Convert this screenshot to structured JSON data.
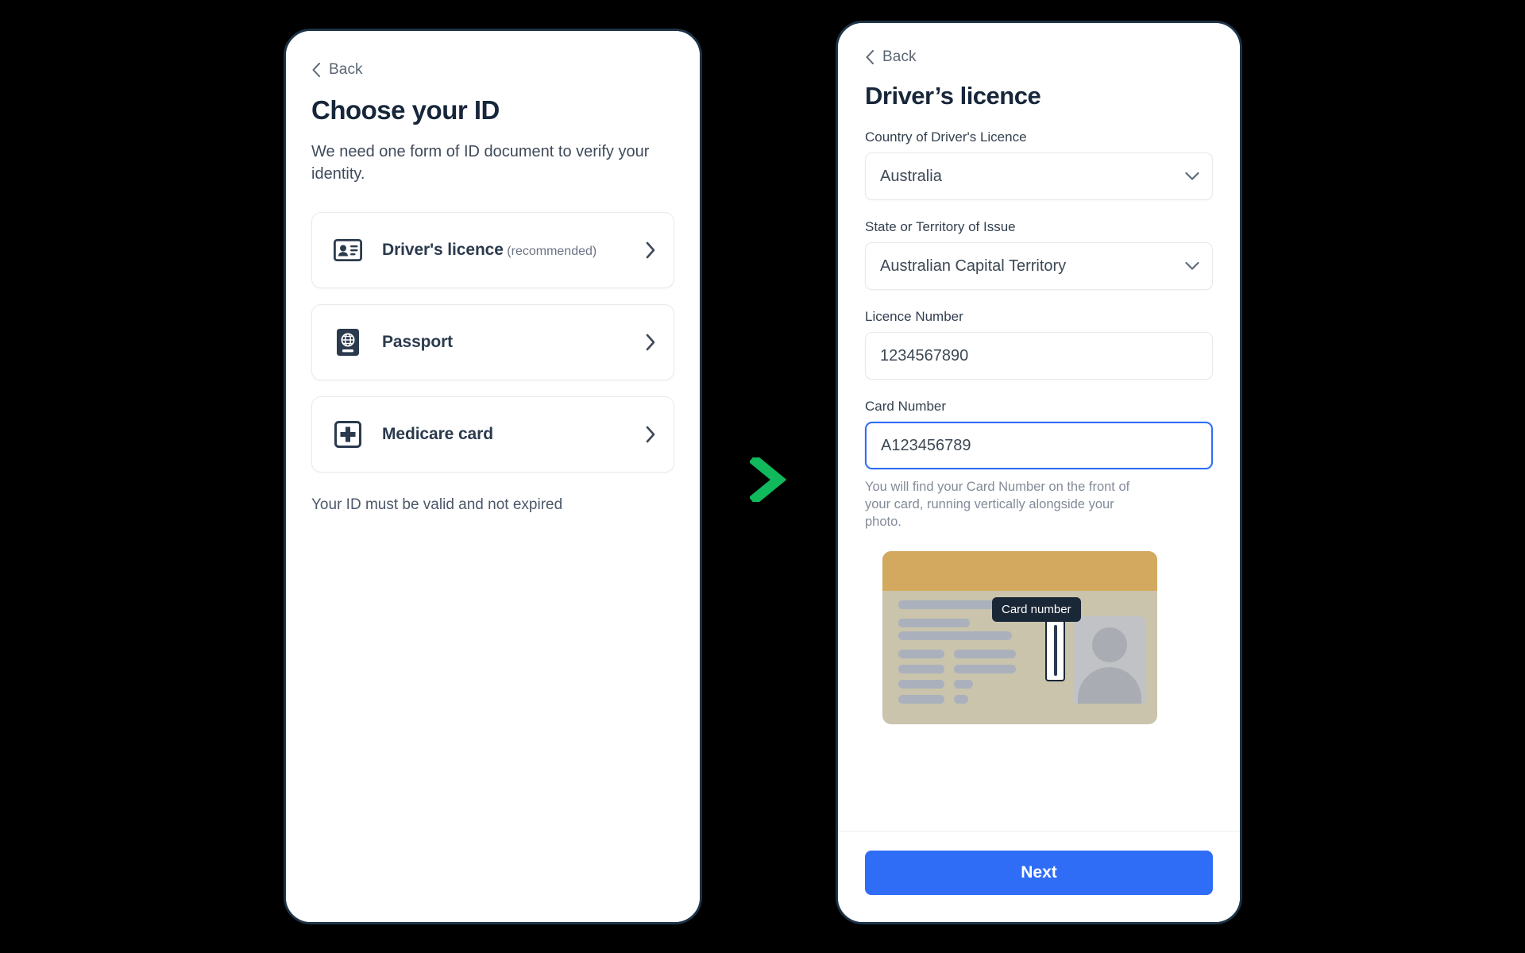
{
  "theme": {
    "accent_blue": "#2f6df6",
    "arrow_green": "#10b95b",
    "ink": "#17263a",
    "muted": "#838b99",
    "frame": "#1d3347"
  },
  "flow": {
    "arrow_icon": "chevron-right-icon"
  },
  "left_screen": {
    "back_label": "Back",
    "back_icon": "chevron-left-icon",
    "title": "Choose your ID",
    "subtitle": "We need one form of ID document to verify your identity.",
    "options": [
      {
        "label": "Driver's licence",
        "note": "(recommended)",
        "icon": "id-card-icon",
        "arrow_icon": "chevron-right-icon"
      },
      {
        "label": "Passport",
        "note": "",
        "icon": "passport-icon",
        "arrow_icon": "chevron-right-icon"
      },
      {
        "label": "Medicare card",
        "note": "",
        "icon": "medical-cross-icon",
        "arrow_icon": "chevron-right-icon"
      }
    ],
    "footer_note": "Your ID must be valid and not expired"
  },
  "right_screen": {
    "back_label": "Back",
    "back_icon": "chevron-left-icon",
    "title": "Driver’s licence",
    "fields": [
      {
        "label": "Country of Driver's Licence",
        "value": "Australia",
        "type": "select",
        "icon": "chevron-down-icon",
        "focused": false
      },
      {
        "label": "State or Territory of Issue",
        "value": "Australian Capital Territory",
        "type": "select",
        "icon": "chevron-down-icon",
        "focused": false
      },
      {
        "label": "Licence Number",
        "value": "1234567890",
        "type": "text",
        "focused": false
      },
      {
        "label": "Card Number",
        "value": "A123456789",
        "type": "text",
        "focused": true
      }
    ],
    "card_number_hint": "You will find your Card Number on the front of your card, running vertically alongside your photo.",
    "illustration": {
      "tooltip_label": "Card number",
      "band_color": "#d2a95f",
      "card_color": "#c9c4ab"
    },
    "primary_button": "Next"
  }
}
